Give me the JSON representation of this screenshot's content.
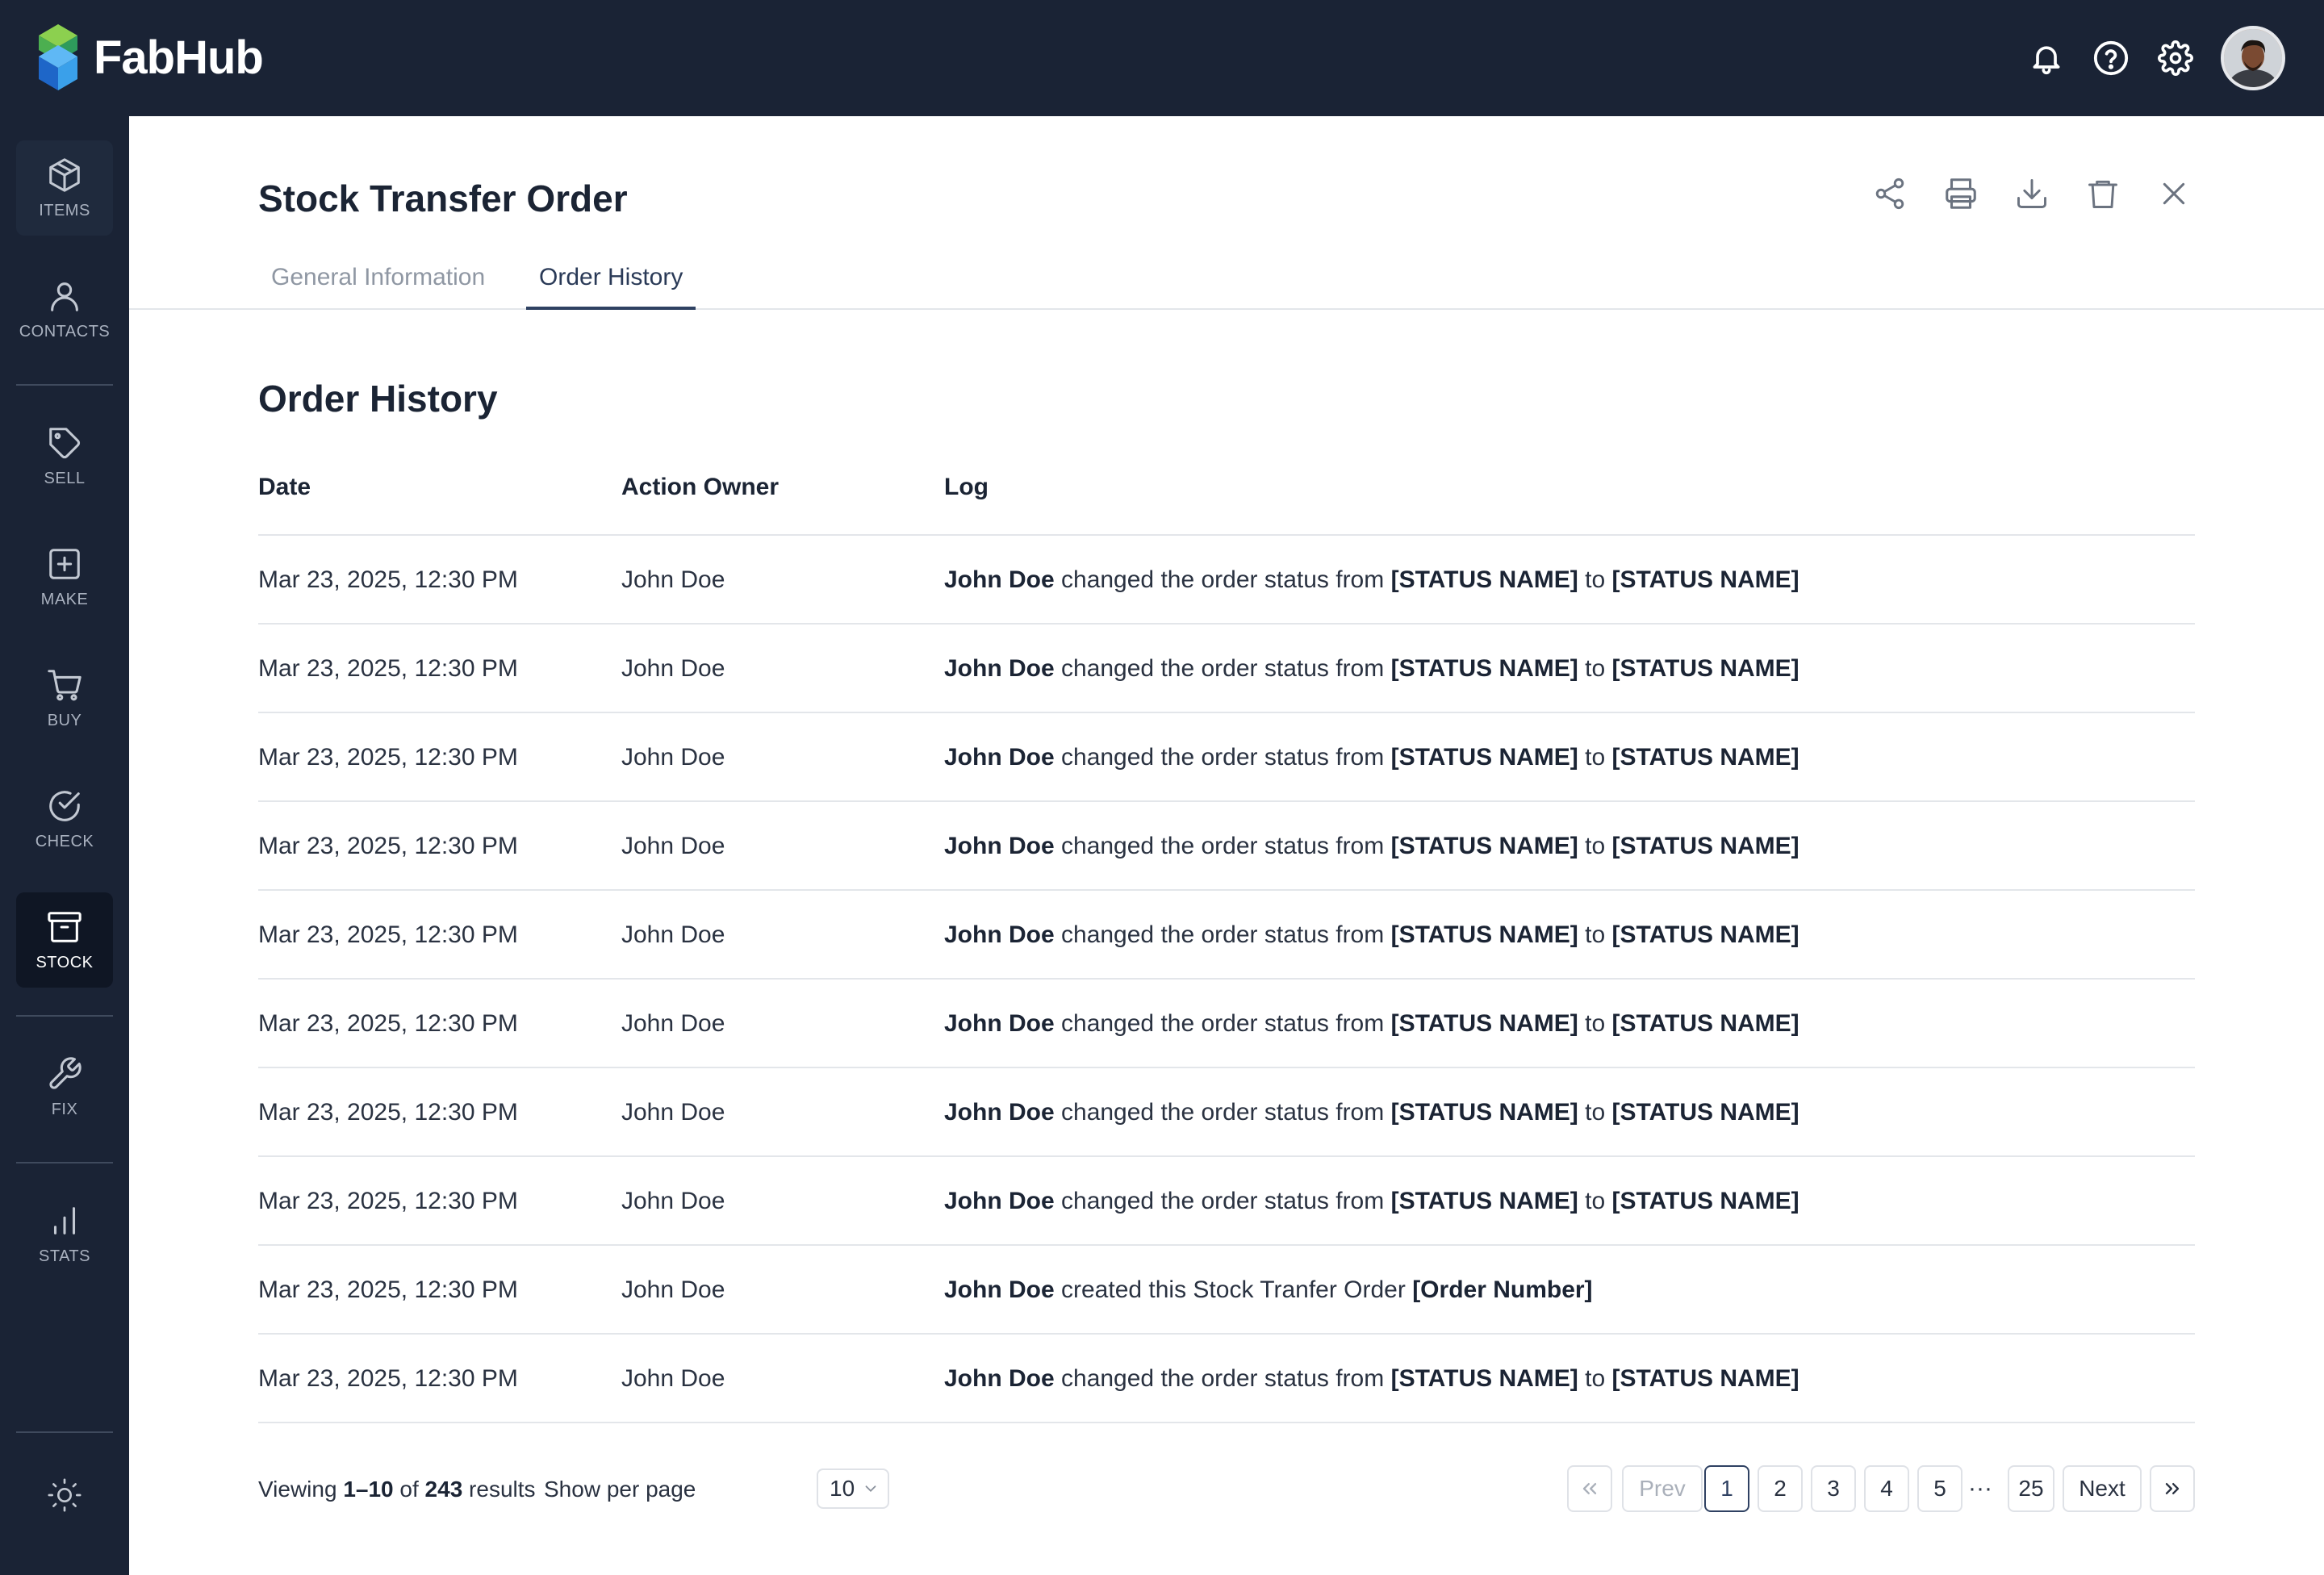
{
  "app": {
    "brand": "FabHub"
  },
  "header": {
    "icons": [
      "bell-icon",
      "help-icon",
      "gear-icon"
    ],
    "avatar_alt": "user avatar"
  },
  "sidebar": {
    "items": [
      {
        "label": "ITEMS",
        "icon": "box-icon"
      },
      {
        "label": "CONTACTS",
        "icon": "user-icon"
      },
      {
        "label": "SELL",
        "icon": "tag-icon"
      },
      {
        "label": "MAKE",
        "icon": "plus-square-icon"
      },
      {
        "label": "BUY",
        "icon": "cart-icon"
      },
      {
        "label": "CHECK",
        "icon": "check-circle-icon"
      },
      {
        "label": "STOCK",
        "icon": "archive-icon"
      },
      {
        "label": "FIX",
        "icon": "wrench-icon"
      },
      {
        "label": "STATS",
        "icon": "bar-chart-icon"
      }
    ],
    "active": "STOCK",
    "theme_icon": "sun-icon"
  },
  "page": {
    "title": "Stock Transfer Order",
    "actions": [
      "share-icon",
      "print-icon",
      "download-icon",
      "trash-icon",
      "close-icon"
    ],
    "tabs": [
      {
        "label": "General Information",
        "active": false
      },
      {
        "label": "Order History",
        "active": true
      }
    ],
    "section_title": "Order History"
  },
  "table": {
    "headers": [
      "Date",
      "Action Owner",
      "Log"
    ],
    "rows": [
      {
        "date": "Mar 23, 2025, 12:30 PM",
        "owner": "John Doe",
        "actor": "John Doe",
        "text1": " changed the order status from ",
        "bold1": "[STATUS NAME]",
        "text2": " to ",
        "bold2": "[STATUS NAME]"
      },
      {
        "date": "Mar 23, 2025, 12:30 PM",
        "owner": "John Doe",
        "actor": "John Doe",
        "text1": " changed the order status from ",
        "bold1": "[STATUS NAME]",
        "text2": " to ",
        "bold2": "[STATUS NAME]"
      },
      {
        "date": "Mar 23, 2025, 12:30 PM",
        "owner": "John Doe",
        "actor": "John Doe",
        "text1": " changed the order status from ",
        "bold1": "[STATUS NAME]",
        "text2": " to ",
        "bold2": "[STATUS NAME]"
      },
      {
        "date": "Mar 23, 2025, 12:30 PM",
        "owner": "John Doe",
        "actor": "John Doe",
        "text1": " changed the order status from ",
        "bold1": "[STATUS NAME]",
        "text2": " to ",
        "bold2": "[STATUS NAME]"
      },
      {
        "date": "Mar 23, 2025, 12:30 PM",
        "owner": "John Doe",
        "actor": "John Doe",
        "text1": " changed the order status from ",
        "bold1": "[STATUS NAME]",
        "text2": " to ",
        "bold2": "[STATUS NAME]"
      },
      {
        "date": "Mar 23, 2025, 12:30 PM",
        "owner": "John Doe",
        "actor": "John Doe",
        "text1": " changed the order status from ",
        "bold1": "[STATUS NAME]",
        "text2": " to ",
        "bold2": "[STATUS NAME]"
      },
      {
        "date": "Mar 23, 2025, 12:30 PM",
        "owner": "John Doe",
        "actor": "John Doe",
        "text1": " changed the order status from ",
        "bold1": "[STATUS NAME]",
        "text2": " to ",
        "bold2": "[STATUS NAME]"
      },
      {
        "date": "Mar 23, 2025, 12:30 PM",
        "owner": "John Doe",
        "actor": "John Doe",
        "text1": " changed the order status from ",
        "bold1": "[STATUS NAME]",
        "text2": " to ",
        "bold2": "[STATUS NAME]"
      },
      {
        "date": "Mar 23, 2025, 12:30 PM",
        "owner": "John Doe",
        "actor": "John Doe",
        "text1": " created this Stock Tranfer Order ",
        "bold1": "[Order Number]",
        "text2": "",
        "bold2": ""
      },
      {
        "date": "Mar 23, 2025, 12:30 PM",
        "owner": "John Doe",
        "actor": "John Doe",
        "text1": " changed the order status from ",
        "bold1": "[STATUS NAME]",
        "text2": " to ",
        "bold2": "[STATUS NAME]"
      }
    ]
  },
  "footer": {
    "viewing_prefix": "Viewing ",
    "viewing_range": "1–10",
    "viewing_of": " of ",
    "viewing_total": "243",
    "viewing_suffix": " results",
    "show_per_page_label": "Show per page",
    "per_page_value": "10",
    "pager": {
      "first_icon": "double-chevron-left-icon",
      "prev": "Prev",
      "pages": [
        "1",
        "2",
        "3",
        "4",
        "5"
      ],
      "ellipsis": "···",
      "last_page": "25",
      "next": "Next",
      "last_icon": "double-chevron-right-icon",
      "current": "1"
    }
  },
  "colors": {
    "nav_bg": "#1a2335",
    "nav_active_bg": "#0f1624",
    "accent": "#2f4162",
    "text": "#1b2434",
    "border": "#e3e6ea"
  }
}
